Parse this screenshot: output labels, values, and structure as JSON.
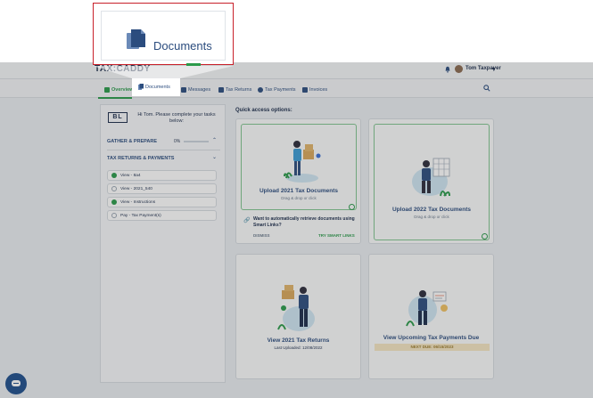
{
  "app": {
    "logo": "TAX:CADDY",
    "user_name": "Tom Taxpayer",
    "user_caret": "▾"
  },
  "nav": {
    "items": [
      {
        "label": "Overview",
        "icon": "home-icon"
      },
      {
        "label": "Documents",
        "icon": "documents-icon"
      },
      {
        "label": "Messages",
        "icon": "messages-icon"
      },
      {
        "label": "Tax Returns",
        "icon": "tax-returns-icon"
      },
      {
        "label": "Tax Payments",
        "icon": "tax-payments-icon"
      },
      {
        "label": "Invoices",
        "icon": "invoices-icon"
      }
    ],
    "active": "Overview"
  },
  "callout": {
    "label": "Documents",
    "icon": "documents-icon"
  },
  "tasks_panel": {
    "initials": "BL",
    "greeting": "Hi Tom. Please complete your tasks below:",
    "sections": [
      {
        "title": "GATHER & PREPARE",
        "percent": "0%",
        "progress": 0
      },
      {
        "title": "TAX RETURNS & PAYMENTS"
      }
    ],
    "tasks": [
      {
        "label": "View - 8a4",
        "done": true
      },
      {
        "label": "View - 2021_540",
        "done": false
      },
      {
        "label": "View - Instructions",
        "done": true
      },
      {
        "label": "Pay - Tax Payment(s)",
        "done": false
      }
    ]
  },
  "quick_access": {
    "title": "Quick access options:",
    "cards": {
      "upload_2021": {
        "title": "Upload 2021 Tax Documents",
        "subtitle": "Drag & drop or click"
      },
      "upload_2022": {
        "title": "Upload 2022 Tax Documents",
        "subtitle": "Drag & drop or click"
      },
      "view_returns": {
        "title": "View 2021 Tax Returns",
        "subtitle": "Last Uploaded: 12/08/2022"
      },
      "view_payments": {
        "title": "View Upcoming Tax Payments Due",
        "due": "NEXT DUE: 06/15/2023"
      }
    },
    "smart_links": {
      "text": "Want to automatically retrieve documents using Smart Links?",
      "dismiss": "DISMISS",
      "try": "TRY SMART LINKS"
    }
  },
  "colors": {
    "accent_green": "#2a9a4a",
    "brand_blue": "#2b4c7e",
    "callout_red": "#c8202a"
  }
}
